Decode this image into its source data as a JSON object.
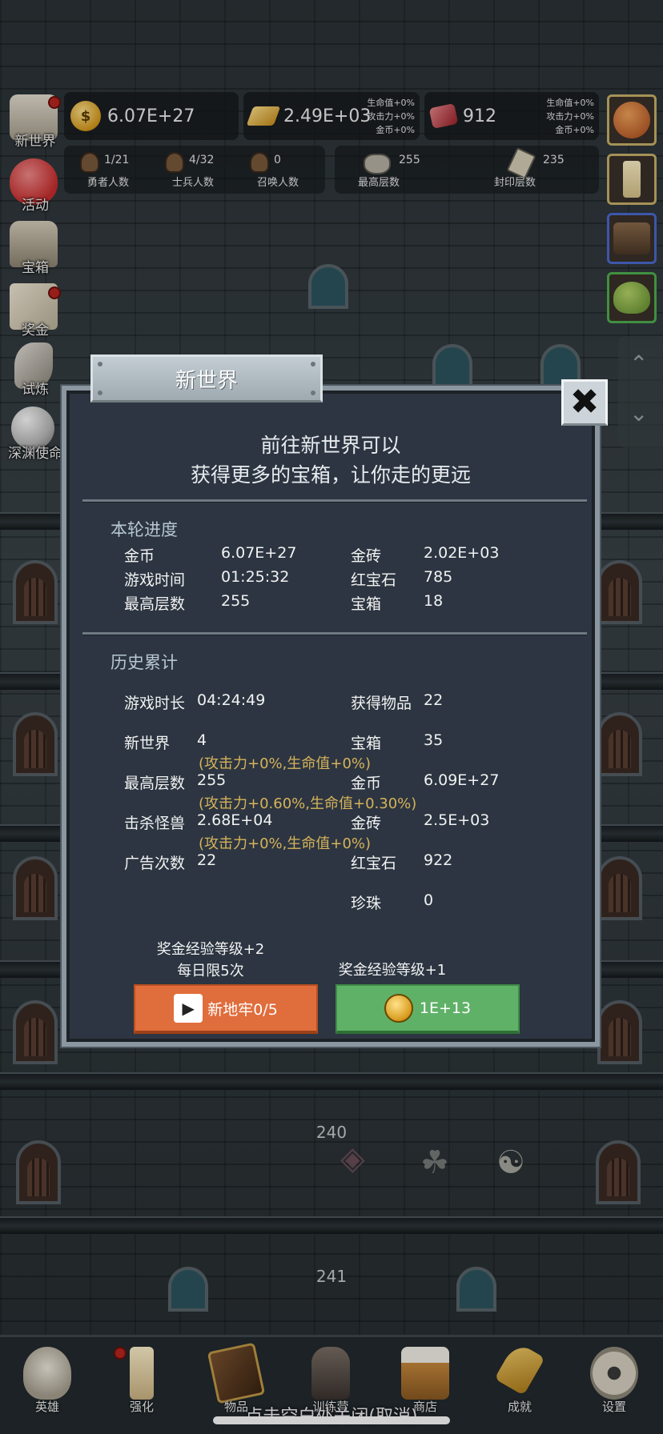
{
  "resources": {
    "gold": {
      "icon": "gold-coin-icon",
      "value": "6.07E+27"
    },
    "brick": {
      "icon": "gold-brick-icon",
      "value": "2.49E+03",
      "mods": [
        "生命值+0%",
        "攻击力+0%",
        "金币+0%"
      ]
    },
    "ruby": {
      "icon": "ruby-icon",
      "value": "912",
      "mods": [
        "生命值+0%",
        "攻击力+0%",
        "金币+0%"
      ]
    }
  },
  "counts": [
    {
      "value": "1/21",
      "label": "勇者人数"
    },
    {
      "value": "4/32",
      "label": "士兵人数"
    },
    {
      "value": "0",
      "label": "召唤人数"
    }
  ],
  "floors": [
    {
      "value": "255",
      "label": "最高层数"
    },
    {
      "value": "235",
      "label": "封印层数"
    }
  ],
  "left_menu": [
    "新世界",
    "活动",
    "宝箱",
    "奖金",
    "试炼",
    "深渊使命"
  ],
  "floor_numbers": [
    "240",
    "241"
  ],
  "dialog": {
    "title": "新世界",
    "intro_line1": "前往新世界可以",
    "intro_line2": "获得更多的宝箱，让你走的更远",
    "current_title": "本轮进度",
    "current": [
      {
        "label": "金币",
        "value": "6.07E+27"
      },
      {
        "label": "金砖",
        "value": "2.02E+03"
      },
      {
        "label": "游戏时间",
        "value": "01:25:32"
      },
      {
        "label": "红宝石",
        "value": "785"
      },
      {
        "label": "最高层数",
        "value": "255"
      },
      {
        "label": "宝箱",
        "value": "18"
      }
    ],
    "history_title": "历史累计",
    "history": [
      {
        "label": "游戏时长",
        "value": "04:24:49"
      },
      {
        "label": "获得物品",
        "value": "22"
      },
      {
        "label": "新世界",
        "value": "4"
      },
      {
        "label": "宝箱",
        "value": "35"
      },
      {
        "label": "最高层数",
        "value": "255"
      },
      {
        "label": "金币",
        "value": "6.09E+27"
      },
      {
        "label": "击杀怪兽",
        "value": "2.68E+04"
      },
      {
        "label": "金砖",
        "value": "2.5E+03"
      },
      {
        "label": "广告次数",
        "value": "22"
      },
      {
        "label": "红宝石",
        "value": "922"
      },
      {
        "label": "珍珠",
        "value": "0"
      }
    ],
    "bonuses": [
      "(攻击力+0%,生命值+0%)",
      "(攻击力+0.60%,生命值+0.30%)",
      "(攻击力+0%,生命值+0%)"
    ],
    "ad_caption_line1": "奖金经验等级+2",
    "ad_caption_line2": "每日限5次",
    "ad_button": "新地牢0/5",
    "coin_caption": "奖金经验等级+1",
    "coin_button": "1E+13"
  },
  "bottom_nav": [
    "英雄",
    "强化",
    "物品",
    "训练营",
    "商店",
    "成就",
    "设置"
  ],
  "bottom_hint": "点击空白处关闭(取消)",
  "colors": {
    "dialog_bg": "#2c3541",
    "orange_button": "#e06d3c",
    "green_button": "#5fb168",
    "bonus_text": "#d6b35b"
  }
}
